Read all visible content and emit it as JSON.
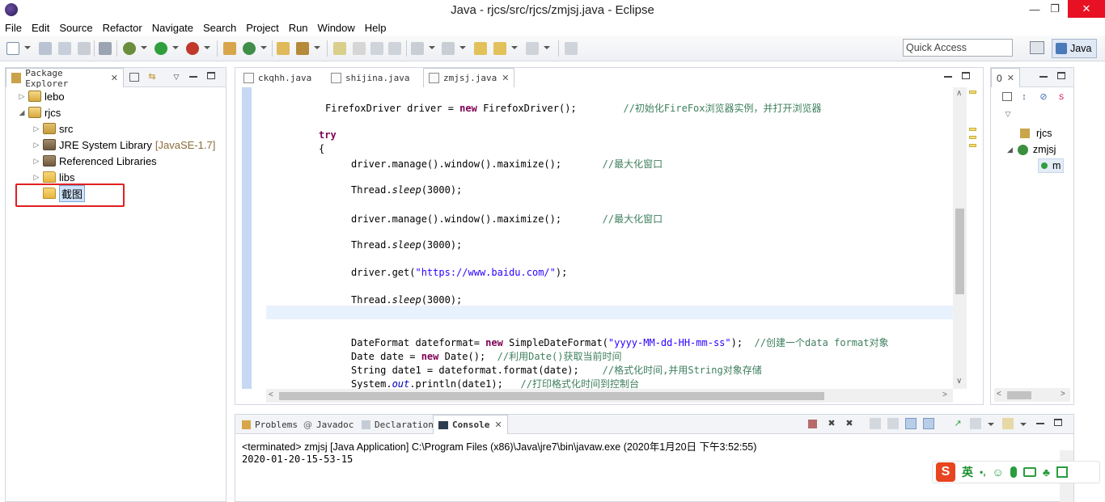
{
  "window": {
    "title": "Java - rjcs/src/rjcs/zmjsj.java - Eclipse",
    "minimize": "—",
    "restore": "❐",
    "close": "✕"
  },
  "menu": [
    "File",
    "Edit",
    "Source",
    "Refactor",
    "Navigate",
    "Search",
    "Project",
    "Run",
    "Window",
    "Help"
  ],
  "toolbar": {
    "quick_access_placeholder": "Quick Access",
    "perspective": "Java"
  },
  "package_explorer": {
    "tab": "Package Explorer",
    "tree": [
      {
        "label": "lebo",
        "level": 0,
        "expanded": false,
        "icon": "project-icon"
      },
      {
        "label": "rjcs",
        "level": 0,
        "expanded": true,
        "icon": "project-icon"
      },
      {
        "label": "src",
        "level": 1,
        "expanded": false,
        "icon": "source-folder-icon"
      },
      {
        "label": "JRE System Library",
        "suffix": "[JavaSE-1.7]",
        "level": 1,
        "expanded": false,
        "icon": "library-icon"
      },
      {
        "label": "Referenced Libraries",
        "level": 1,
        "expanded": false,
        "icon": "library-icon"
      },
      {
        "label": "libs",
        "level": 1,
        "expanded": false,
        "icon": "folder-icon"
      },
      {
        "label": "截图",
        "level": 1,
        "expanded": null,
        "icon": "folder-icon",
        "selected": true
      }
    ]
  },
  "editor": {
    "tabs": [
      {
        "label": "ckqhh.java",
        "active": false
      },
      {
        "label": "shijina.java",
        "active": false
      },
      {
        "label": "zmjsj.java",
        "active": true
      }
    ]
  },
  "outline": {
    "tab": "0",
    "items": [
      {
        "label": "rjcs",
        "icon": "package-icon"
      },
      {
        "label": "zmjsj",
        "icon": "class-icon"
      },
      {
        "label": "m",
        "icon": "method-icon"
      }
    ]
  },
  "bottom": {
    "tabs": [
      "Problems",
      "Javadoc",
      "Declaration",
      "Console"
    ],
    "active_tab": "Console",
    "console_header": "<terminated> zmjsj [Java Application] C:\\Program Files (x86)\\Java\\jre7\\bin\\javaw.exe (2020年1月20日 下午3:52:55)",
    "console_output": "2020-01-20-15-53-15"
  },
  "ime": {
    "logo": "S",
    "mode": "英",
    "punct": "•,"
  }
}
